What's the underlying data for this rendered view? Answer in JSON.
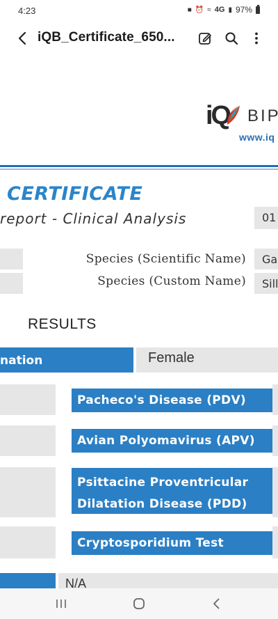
{
  "status_bar": {
    "time": "4:23",
    "network": "4G",
    "battery": "97%"
  },
  "app_bar": {
    "title": "iQB_Certificate_650..."
  },
  "logo": {
    "iq": "iQ",
    "brand_partial": "BIP",
    "url_partial": "www.iq"
  },
  "certificate": {
    "title": "CERTIFICATE",
    "subtitle": "report - Clinical Analysis",
    "date_partial": "01"
  },
  "fields": [
    {
      "label": "Species (Scientific Name)",
      "value": "Ga"
    },
    {
      "label": "Species (Custom Name)",
      "value": "Sill"
    }
  ],
  "results": {
    "heading": "RESULTS",
    "gender_header": "nation",
    "gender_value": "Female",
    "tests": [
      {
        "line1": "Pacheco's Disease (PDV)"
      },
      {
        "line1": "Avian Polyomavirus (APV)"
      },
      {
        "line1": "Psittacine Proventricular",
        "line2": "Dilatation Disease (PDD)"
      },
      {
        "line1": "Cryptosporidium Test"
      }
    ],
    "na_value": "N/A"
  },
  "colors": {
    "accent_blue": "#2b7fc4",
    "title_blue": "#2a85c9",
    "cell_gray": "#e6e6e6"
  },
  "icons": {
    "back": "chevron-left-icon",
    "edit": "edit-icon",
    "search": "search-icon",
    "more": "more-vertical-icon",
    "nav_recent": "recent-apps-icon",
    "nav_home": "home-icon",
    "nav_back": "nav-back-icon"
  }
}
